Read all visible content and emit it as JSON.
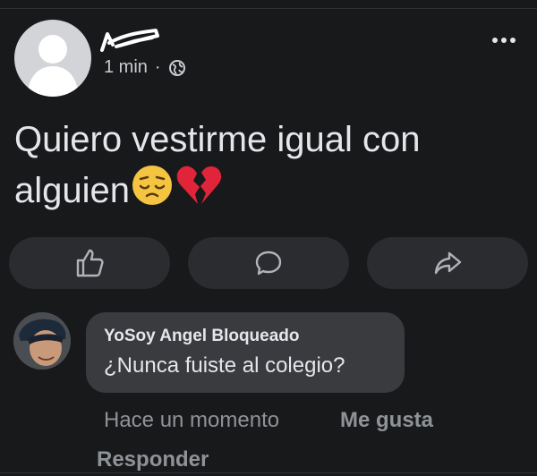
{
  "post": {
    "time": "1 min",
    "separator": "·",
    "privacy_icon": "globe-icon",
    "more_icon": "more-options-icon",
    "text_line1": "Quiero vestirme igual con",
    "text_line2": "alguien",
    "emojis": [
      "pensive-face-emoji",
      "broken-heart-emoji"
    ]
  },
  "actions": {
    "like_icon": "thumbs-up-icon",
    "comment_icon": "comment-icon",
    "share_icon": "share-icon"
  },
  "comment": {
    "author": "YoSoy Angel Bloqueado",
    "text": "¿Nunca fuiste al colegio?",
    "time": "Hace un momento",
    "like_label": "Me gusta",
    "reply_label": "Responder"
  },
  "colors": {
    "background": "#18191b",
    "button": "#2b2c30",
    "bubble": "#3a3b3f",
    "muted_text": "#8f9297"
  }
}
